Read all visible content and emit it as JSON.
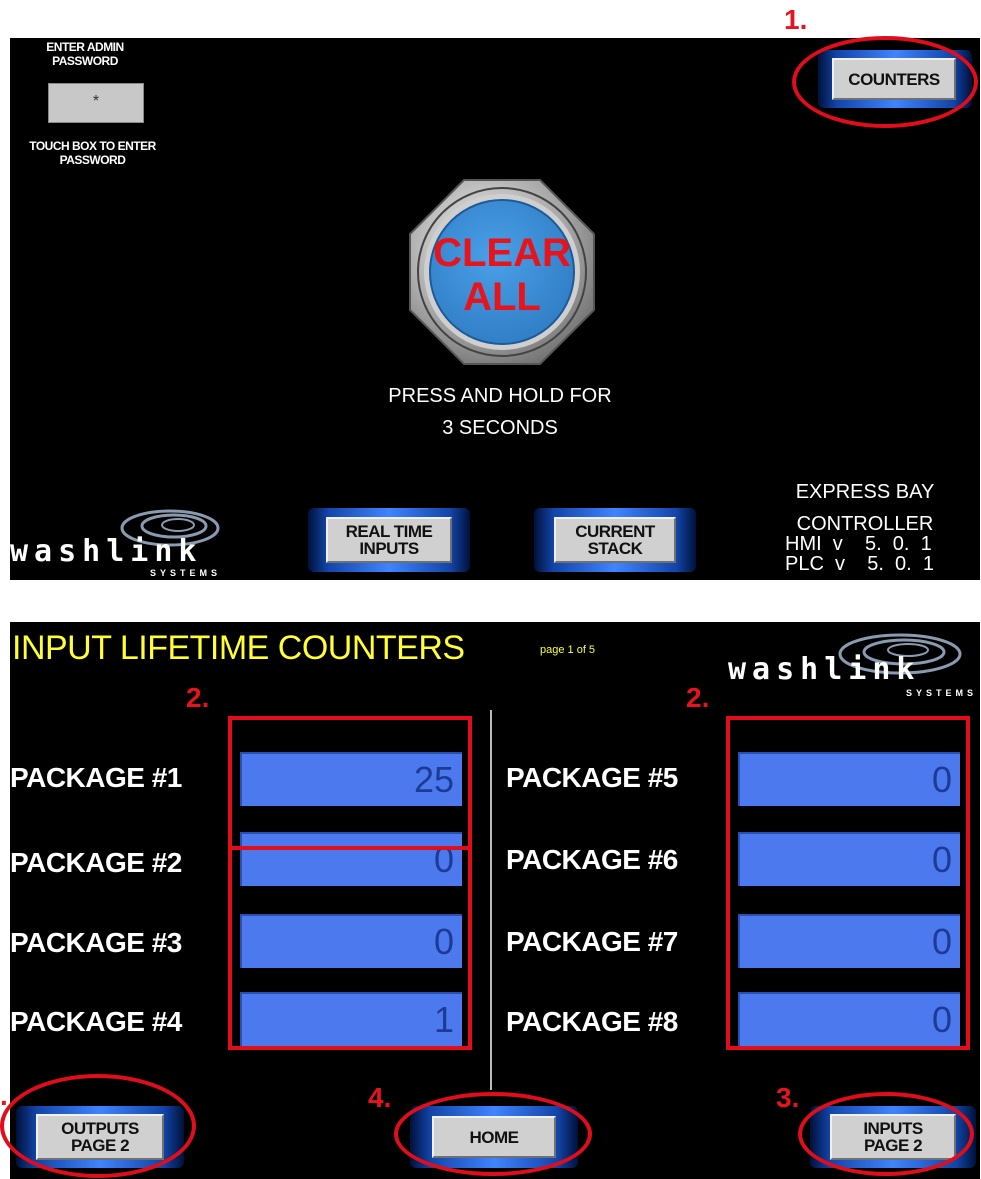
{
  "annotations": {
    "one": "1.",
    "two_left": "2.",
    "two_right": "2.",
    "three": "3.",
    "four": "4.",
    "five_partial": "."
  },
  "top_screen": {
    "password_prompt": "ENTER ADMIN PASSWORD",
    "password_value": "*",
    "password_hint": "TOUCH BOX TO ENTER PASSWORD",
    "counters_button": "COUNTERS",
    "clear_button_line1": "CLEAR",
    "clear_button_line2": "ALL",
    "press_hold_line1": "PRESS AND HOLD FOR",
    "press_hold_line2": "3 SECONDS",
    "real_time_inputs_line1": "REAL TIME",
    "real_time_inputs_line2": "INPUTS",
    "current_stack_line1": "CURRENT",
    "current_stack_line2": "STACK",
    "express_line1": "EXPRESS BAY",
    "express_line2": "CONTROLLER",
    "hmi_version": "HMI  v    5.  0.  1",
    "plc_version": "PLC  v    5.  0.  1",
    "logo_text": "washlink",
    "logo_sub": "SYSTEMS"
  },
  "bottom_screen": {
    "title": "INPUT LIFETIME COUNTERS",
    "page_indicator": "page 1 of 5",
    "logo_text": "washlink",
    "logo_sub": "SYSTEMS",
    "left_packages": [
      {
        "label": "PACKAGE #1",
        "value": "25"
      },
      {
        "label": "PACKAGE #2",
        "value": "0"
      },
      {
        "label": "PACKAGE #3",
        "value": "0"
      },
      {
        "label": "PACKAGE #4",
        "value": "1"
      }
    ],
    "right_packages": [
      {
        "label": "PACKAGE #5",
        "value": "0"
      },
      {
        "label": "PACKAGE #6",
        "value": "0"
      },
      {
        "label": "PACKAGE #7",
        "value": "0"
      },
      {
        "label": "PACKAGE #8",
        "value": "0"
      }
    ],
    "outputs_page2_line1": "OUTPUTS",
    "outputs_page2_line2": "PAGE 2",
    "home_button": "HOME",
    "inputs_page2_line1": "INPUTS",
    "inputs_page2_line2": "PAGE 2"
  },
  "colors": {
    "screen_bg": "#000000",
    "value_box": "#4d79ef",
    "title_yellow": "#ffff33",
    "annotation_red": "#e10d1a",
    "clear_text_red": "#e8141c",
    "clear_button_blue": "#3d8fd6"
  }
}
